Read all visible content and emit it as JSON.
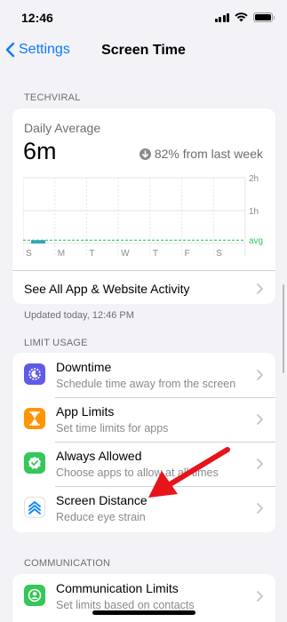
{
  "status": {
    "time": "12:46"
  },
  "nav": {
    "back_label": "Settings",
    "title": "Screen Time"
  },
  "device_section": {
    "header": "TECHVIRAL"
  },
  "summary": {
    "label": "Daily Average",
    "value": "6m",
    "change": "82% from last week",
    "see_all_label": "See All App & Website Activity",
    "updated": "Updated today, 12:46 PM"
  },
  "chart_data": {
    "type": "bar",
    "categories": [
      "S",
      "M",
      "T",
      "W",
      "T",
      "F",
      "S"
    ],
    "values_minutes": [
      6,
      0,
      0,
      0,
      0,
      0,
      0
    ],
    "y_tick_labels": [
      "2h",
      "1h"
    ],
    "ylim_minutes": [
      0,
      120
    ],
    "average_label": "avg",
    "average_minutes": 6,
    "colors": {
      "bar": "#31a3c4",
      "avg_line": "#34c759",
      "grid": "#e5e5ea"
    }
  },
  "limit_section": {
    "header": "LIMIT USAGE",
    "items": [
      {
        "title": "Downtime",
        "subtitle": "Schedule time away from the screen",
        "icon": "downtime-moon-icon",
        "color": "#5e5ce6"
      },
      {
        "title": "App Limits",
        "subtitle": "Set time limits for apps",
        "icon": "hourglass-icon",
        "color": "#ff9500"
      },
      {
        "title": "Always Allowed",
        "subtitle": "Choose apps to allow at all times",
        "icon": "checkmark-icon",
        "color": "#34c759"
      },
      {
        "title": "Screen Distance",
        "subtitle": "Reduce eye strain",
        "icon": "screen-distance-chevrons-icon",
        "color": "#ffffff"
      }
    ]
  },
  "communication_section": {
    "header": "COMMUNICATION",
    "items": [
      {
        "title": "Communication Limits",
        "subtitle": "Set limits based on contacts",
        "icon": "person-circle-icon",
        "color": "#34c759"
      }
    ]
  },
  "annotation": {
    "color": "#e8141b"
  }
}
